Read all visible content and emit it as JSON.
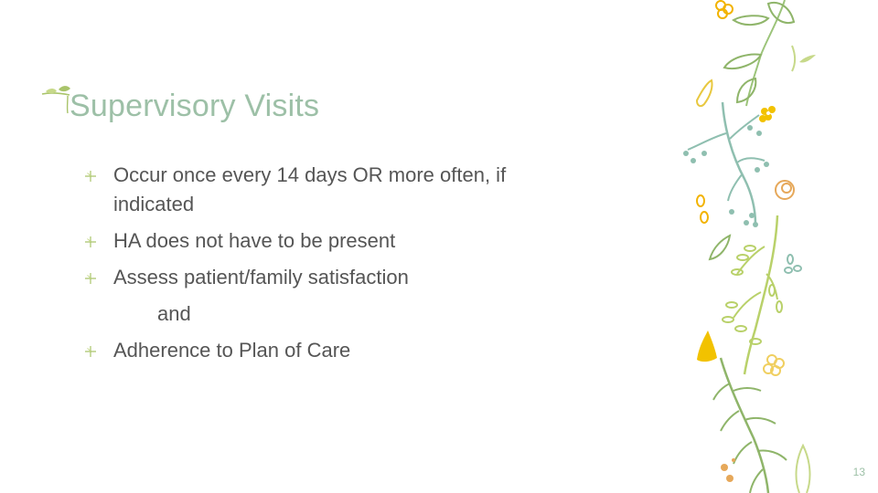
{
  "slide": {
    "title": "Supervisory Visits",
    "bullets": [
      "Occur once every 14 days OR more often, if indicated",
      "HA does not have to be present",
      "Assess patient/family satisfaction"
    ],
    "continuation": "and",
    "final_bullet": "Adherence to Plan of Care",
    "page_number": "13"
  },
  "colors": {
    "title": "#9dc0a7",
    "body_text": "#555555",
    "bullet_mark": "#a9c46a",
    "leaf_green": "#a9c46a",
    "leaf_teal": "#8fbfb0",
    "flower_yellow": "#f2c200",
    "flower_orange": "#e6a85a"
  },
  "icons": {
    "bullet": "sprout-cross-icon",
    "title_decoration": "sprig-icon",
    "decoration": "botanical-vine-illustration"
  }
}
